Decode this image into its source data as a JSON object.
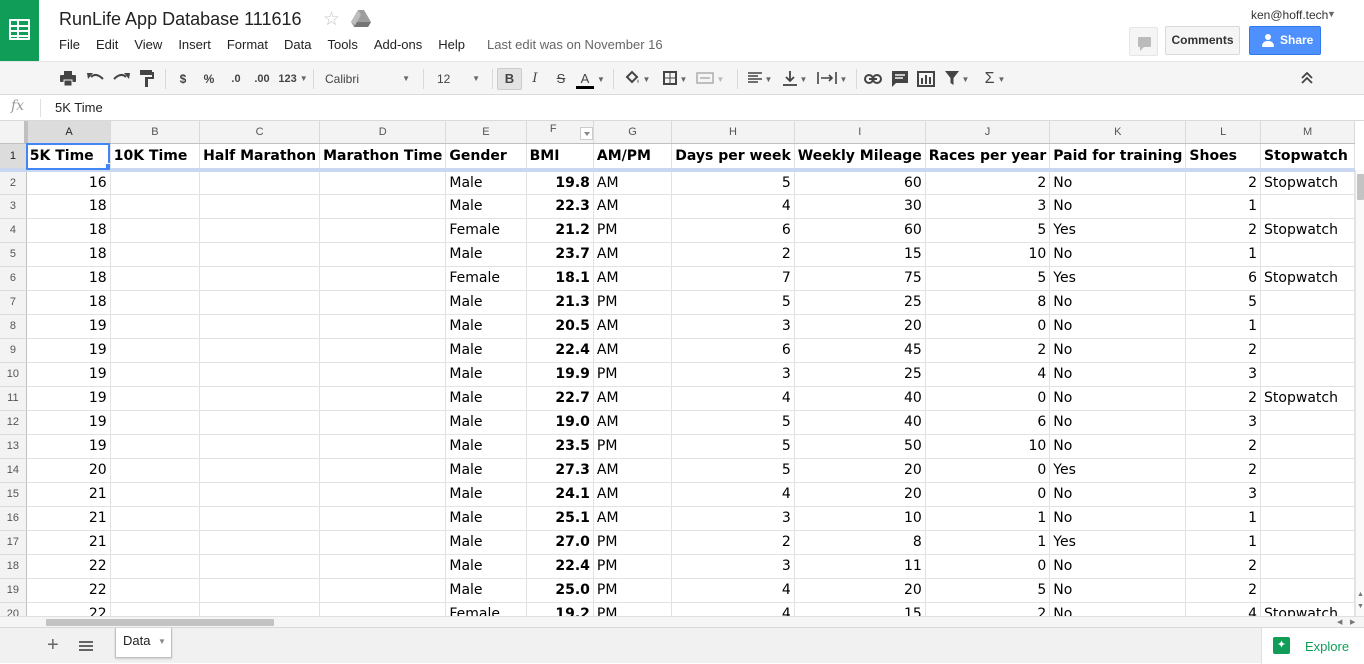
{
  "header": {
    "title": "RunLife App Database 111616",
    "last_edit": "Last edit was on November 16",
    "user_email": "ken@hoff.tech",
    "comments_label": "Comments",
    "share_label": "Share",
    "menu": [
      "File",
      "Edit",
      "View",
      "Insert",
      "Format",
      "Data",
      "Tools",
      "Add-ons",
      "Help"
    ]
  },
  "toolbar": {
    "currency_label": "$",
    "percent_label": "%",
    "decrease_decimal_label": ".0",
    "increase_decimal_label": ".00",
    "number_format_label": "123",
    "font": "Calibri",
    "font_size": "12",
    "bold_label": "B",
    "italic_label": "I",
    "strike_label": "S",
    "text_color_label": "A",
    "sigma_label": "Σ"
  },
  "formula_bar": {
    "fx_label": "fx",
    "value": "5K Time"
  },
  "grid": {
    "columns": [
      "A",
      "B",
      "C",
      "D",
      "E",
      "F",
      "G",
      "H",
      "I",
      "J",
      "K",
      "L",
      "M"
    ],
    "headers": [
      "5K Time",
      "10K Time",
      "Half Marathon",
      "Marathon Time",
      "Gender",
      "BMI",
      "AM/PM",
      "Days per week",
      "Weekly Mileage",
      "Races per year",
      "Paid for training",
      "Shoes",
      "Stopwatch"
    ],
    "rows": [
      {
        "n": "2",
        "v": [
          "16",
          "",
          "",
          "",
          "Male",
          "19.8",
          "AM",
          "5",
          "60",
          "2",
          "No",
          "2",
          "Stopwatch"
        ]
      },
      {
        "n": "3",
        "v": [
          "18",
          "",
          "",
          "",
          "Male",
          "22.3",
          "AM",
          "4",
          "30",
          "3",
          "No",
          "1",
          ""
        ]
      },
      {
        "n": "4",
        "v": [
          "18",
          "",
          "",
          "",
          "Female",
          "21.2",
          "PM",
          "6",
          "60",
          "5",
          "Yes",
          "2",
          "Stopwatch"
        ]
      },
      {
        "n": "5",
        "v": [
          "18",
          "",
          "",
          "",
          "Male",
          "23.7",
          "AM",
          "2",
          "15",
          "10",
          "No",
          "1",
          ""
        ]
      },
      {
        "n": "6",
        "v": [
          "18",
          "",
          "",
          "",
          "Female",
          "18.1",
          "AM",
          "7",
          "75",
          "5",
          "Yes",
          "6",
          "Stopwatch"
        ]
      },
      {
        "n": "7",
        "v": [
          "18",
          "",
          "",
          "",
          "Male",
          "21.3",
          "PM",
          "5",
          "25",
          "8",
          "No",
          "5",
          ""
        ]
      },
      {
        "n": "8",
        "v": [
          "19",
          "",
          "",
          "",
          "Male",
          "20.5",
          "AM",
          "3",
          "20",
          "0",
          "No",
          "1",
          ""
        ]
      },
      {
        "n": "9",
        "v": [
          "19",
          "",
          "",
          "",
          "Male",
          "22.4",
          "AM",
          "6",
          "45",
          "2",
          "No",
          "2",
          ""
        ]
      },
      {
        "n": "10",
        "v": [
          "19",
          "",
          "",
          "",
          "Male",
          "19.9",
          "PM",
          "3",
          "25",
          "4",
          "No",
          "3",
          ""
        ]
      },
      {
        "n": "11",
        "v": [
          "19",
          "",
          "",
          "",
          "Male",
          "22.7",
          "AM",
          "4",
          "40",
          "0",
          "No",
          "2",
          "Stopwatch"
        ]
      },
      {
        "n": "12",
        "v": [
          "19",
          "",
          "",
          "",
          "Male",
          "19.0",
          "AM",
          "5",
          "40",
          "6",
          "No",
          "3",
          ""
        ]
      },
      {
        "n": "13",
        "v": [
          "19",
          "",
          "",
          "",
          "Male",
          "23.5",
          "PM",
          "5",
          "50",
          "10",
          "No",
          "2",
          ""
        ]
      },
      {
        "n": "14",
        "v": [
          "20",
          "",
          "",
          "",
          "Male",
          "27.3",
          "AM",
          "5",
          "20",
          "0",
          "Yes",
          "2",
          ""
        ]
      },
      {
        "n": "15",
        "v": [
          "21",
          "",
          "",
          "",
          "Male",
          "24.1",
          "AM",
          "4",
          "20",
          "0",
          "No",
          "3",
          ""
        ]
      },
      {
        "n": "16",
        "v": [
          "21",
          "",
          "",
          "",
          "Male",
          "25.1",
          "AM",
          "3",
          "10",
          "1",
          "No",
          "1",
          ""
        ]
      },
      {
        "n": "17",
        "v": [
          "21",
          "",
          "",
          "",
          "Male",
          "27.0",
          "PM",
          "2",
          "8",
          "1",
          "Yes",
          "1",
          ""
        ]
      },
      {
        "n": "18",
        "v": [
          "22",
          "",
          "",
          "",
          "Male",
          "22.4",
          "PM",
          "3",
          "11",
          "0",
          "No",
          "2",
          ""
        ]
      },
      {
        "n": "19",
        "v": [
          "22",
          "",
          "",
          "",
          "Male",
          "25.0",
          "PM",
          "4",
          "20",
          "5",
          "No",
          "2",
          ""
        ]
      },
      {
        "n": "20",
        "v": [
          "22",
          "",
          "",
          "",
          "Female",
          "19.2",
          "PM",
          "4",
          "15",
          "2",
          "No",
          "4",
          "Stopwatch"
        ]
      }
    ]
  },
  "sheets": {
    "active": "Data"
  },
  "explore_label": "Explore",
  "colors": {
    "brand_green": "#0f9d58",
    "share_blue": "#4d90fe",
    "selection_blue": "#4285f4"
  }
}
